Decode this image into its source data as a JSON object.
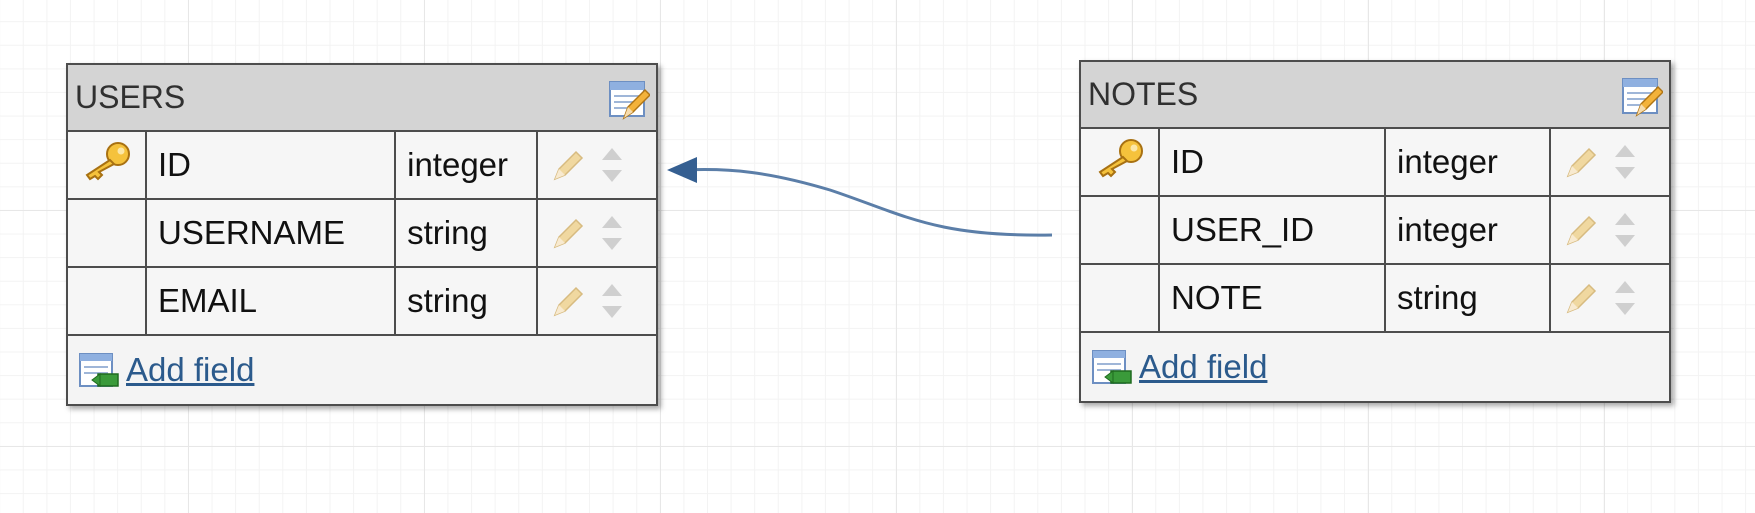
{
  "tables": [
    {
      "name": "USERS",
      "fields": [
        {
          "name": "ID",
          "type": "integer",
          "primary_key": true
        },
        {
          "name": "USERNAME",
          "type": "string",
          "primary_key": false
        },
        {
          "name": "EMAIL",
          "type": "string",
          "primary_key": false
        }
      ],
      "add_field_label": "Add field"
    },
    {
      "name": "NOTES",
      "fields": [
        {
          "name": "ID",
          "type": "integer",
          "primary_key": true
        },
        {
          "name": "USER_ID",
          "type": "integer",
          "primary_key": false
        },
        {
          "name": "NOTE",
          "type": "string",
          "primary_key": false
        }
      ],
      "add_field_label": "Add field"
    }
  ],
  "relation": {
    "from": "NOTES.USER_ID",
    "to": "USERS.ID"
  },
  "colors": {
    "connector": "#355f91",
    "link": "#2b5a8c",
    "header": "#d4d4d4",
    "border": "#4d4d4d"
  }
}
